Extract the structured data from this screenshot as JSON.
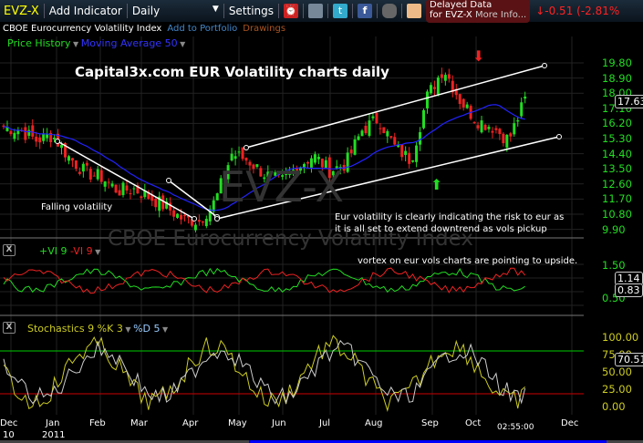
{
  "toolbar": {
    "symbol": "EVZ-X",
    "add_indicator": "Add Indicator",
    "period": "Daily",
    "settings": "Settings",
    "delayed_line1": "Delayed Data",
    "delayed_line2": "for EVZ-X",
    "more_info": "More Info...",
    "change": "-0.51 (-2.81%"
  },
  "subbar": {
    "name": "CBOE Eurocurrency Volatility Index",
    "add_portfolio": "Add to Portfolio",
    "drawings": "Drawings"
  },
  "price_panel": {
    "price_history": "Price History",
    "moving_average": "Moving Average 50",
    "title_annotation": "Capital3x.com EUR Volatility charts daily",
    "falling": "Falling volatility",
    "note1": "Eur volatility is clearly indicating the risk to eur as",
    "note2": "it is all set to extend downtrend as vols pickup",
    "watermark_symbol": "EVZ-X",
    "watermark_name": "CBOE Eurocurrency Volatility Index",
    "axis": [
      "19.80",
      "18.90",
      "18.00",
      "17.10",
      "16.20",
      "15.30",
      "14.40",
      "13.50",
      "12.60",
      "11.70",
      "10.80",
      "9.90"
    ],
    "last": "17.63"
  },
  "vi_panel": {
    "plus": "+VI 9",
    "minus": "-VI 9",
    "note": "vortex on eur vols charts are pointing to upside.",
    "axis": [
      "1.50",
      "0.50"
    ],
    "plus_last": "1.14",
    "minus_last": "0.83"
  },
  "stoch_panel": {
    "label": "Stochastics 9 %K 3",
    "d": "%D 5",
    "axis": [
      "100.00",
      "75.00",
      "50.00",
      "25.00",
      "0.00"
    ],
    "last": "70.51"
  },
  "xaxis": {
    "months": [
      "Dec",
      "Jan",
      "Feb",
      "Mar",
      "Apr",
      "May",
      "Jun",
      "Jul",
      "Aug",
      "Sep",
      "Oct",
      "Dec"
    ],
    "years": [
      "10",
      "2011"
    ],
    "time": "02:55:00"
  },
  "price_keys": [
    16,
    15.8,
    15.2,
    15.5,
    14.2,
    13.3,
    13.0,
    12.2,
    12.3,
    11.8,
    11.2,
    10.5,
    10.4,
    11.6,
    14.4,
    14.0,
    13.2,
    12.7,
    13.6,
    14.3,
    13.4,
    13.8,
    15.8,
    16.5,
    14.8,
    14.0,
    17.8,
    19.5,
    17.6,
    16.4,
    16.0,
    15.2,
    17.6
  ]
}
